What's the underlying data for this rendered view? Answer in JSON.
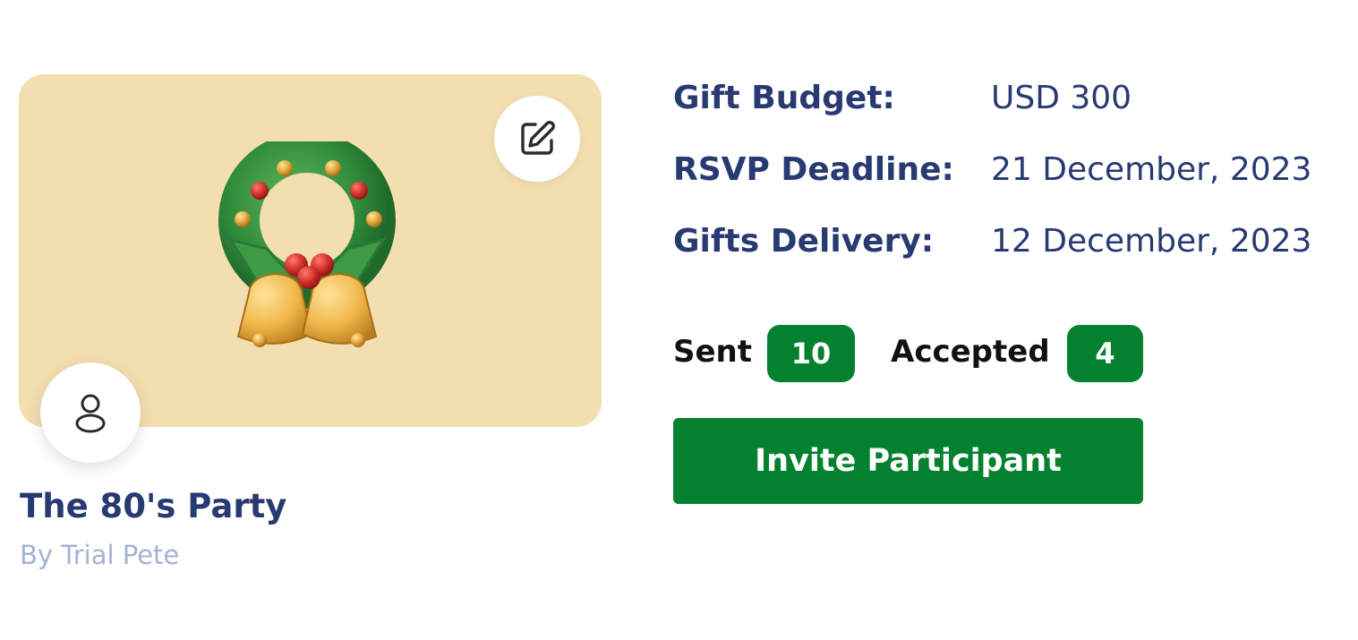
{
  "event": {
    "title": "The 80's Party",
    "owner": "By Trial Pete",
    "cover_color": "#f3deb0"
  },
  "icons": {
    "edit": "edit-icon",
    "avatar": "user-icon",
    "cover_image": "christmas-wreath-with-bells"
  },
  "details": {
    "gift_budget_label": "Gift Budget:",
    "gift_budget_value": "USD 300",
    "rsvp_label": "RSVP Deadline:",
    "rsvp_value": "21 December, 2023",
    "delivery_label": "Gifts Delivery:",
    "delivery_value": "12 December, 2023"
  },
  "stats": {
    "sent_label": "Sent",
    "sent_count": "10",
    "accepted_label": "Accepted",
    "accepted_count": "4"
  },
  "actions": {
    "invite_label": "Invite Participant"
  },
  "colors": {
    "primary_text": "#283a72",
    "muted_text": "#a3b2d6",
    "accent_green": "#03812e"
  }
}
